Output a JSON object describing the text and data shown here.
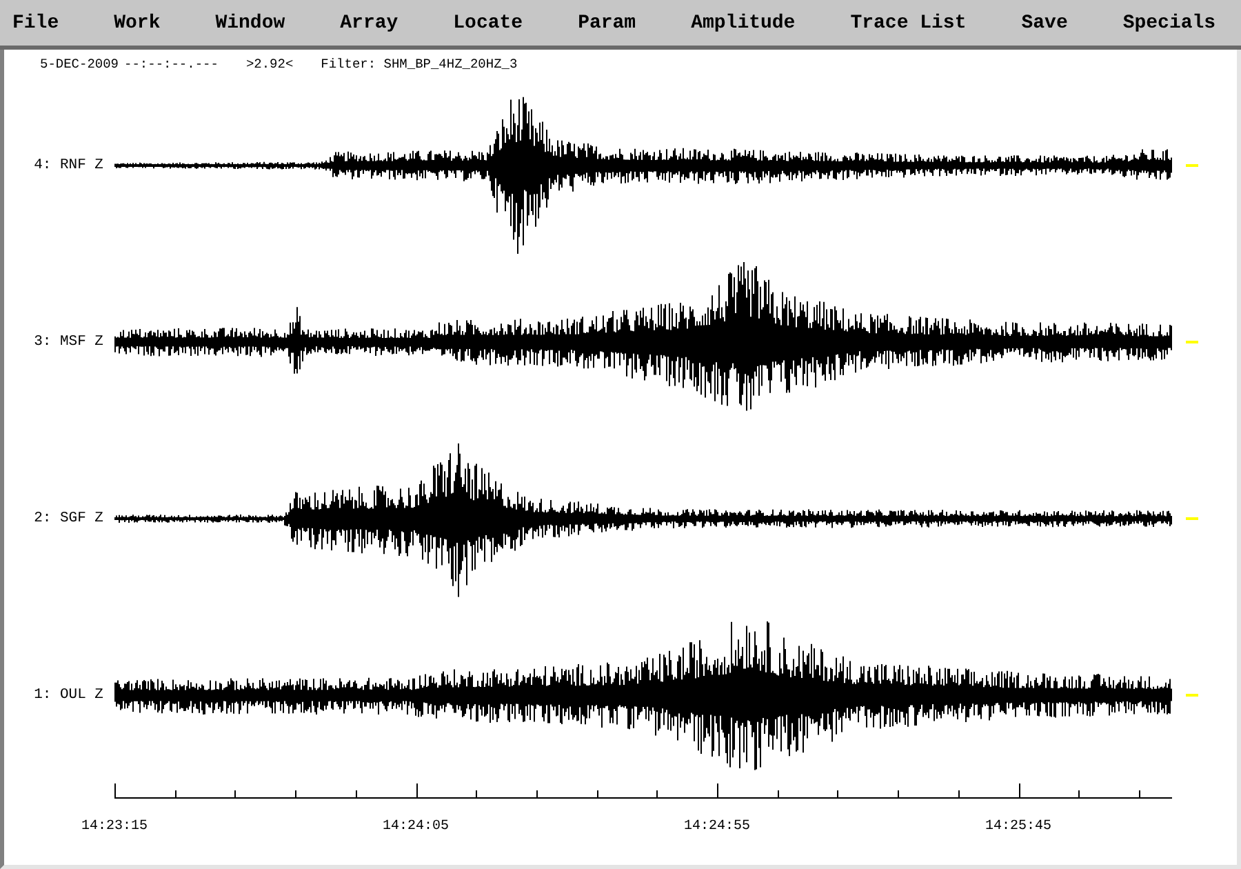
{
  "menu": [
    {
      "label": "File"
    },
    {
      "label": "Work"
    },
    {
      "label": "Window"
    },
    {
      "label": "Array"
    },
    {
      "label": "Locate"
    },
    {
      "label": "Param"
    },
    {
      "label": "Amplitude"
    },
    {
      "label": "Trace List"
    },
    {
      "label": "Save"
    },
    {
      "label": "Specials"
    }
  ],
  "header": {
    "date": "5-DEC-2009",
    "time": "--:--:--.---",
    "amplitude": ">2.92<",
    "filter": "Filter: SHM_BP_4HZ_20HZ_3"
  },
  "traces": [
    {
      "label": "4: RNF Z"
    },
    {
      "label": "3: MSF Z"
    },
    {
      "label": "2: SGF Z"
    },
    {
      "label": "1: OUL Z"
    }
  ],
  "time_axis": {
    "labels": [
      "14:23:15",
      "14:24:05",
      "14:24:55",
      "14:25:45"
    ]
  }
}
